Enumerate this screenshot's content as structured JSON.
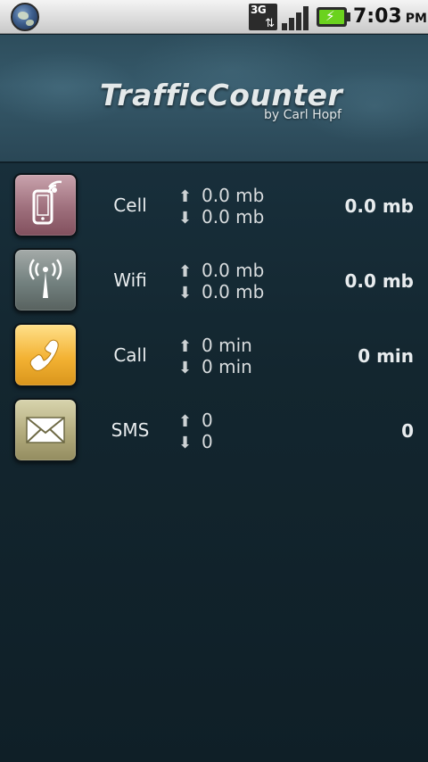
{
  "status_bar": {
    "network_label": "3G",
    "time": "7:03",
    "ampm": "PM",
    "battery_color": "#6bd21e",
    "icons": [
      "globe-icon",
      "3g-data-icon",
      "signal-strength-icon",
      "battery-charging-icon"
    ]
  },
  "header": {
    "title": "TrafficCounter",
    "subtitle": "by Carl Hopf"
  },
  "rows": [
    {
      "label": "Cell",
      "icon": "phone-signal-icon",
      "up": "0.0 mb",
      "down": "0.0 mb",
      "total": "0.0 mb",
      "tile_color": "#9e6f7c"
    },
    {
      "label": "Wifi",
      "icon": "wifi-antenna-icon",
      "up": "0.0 mb",
      "down": "0.0 mb",
      "total": "0.0 mb",
      "tile_color": "#72807e"
    },
    {
      "label": "Call",
      "icon": "phone-handset-icon",
      "up": "0 min",
      "down": "0 min",
      "total": "0 min",
      "tile_color": "#f3b233"
    },
    {
      "label": "SMS",
      "icon": "envelope-icon",
      "up": "0",
      "down": "0",
      "total": "0",
      "tile_color": "#b2ab7d"
    }
  ],
  "arrows": {
    "up": "⬆",
    "down": "⬇"
  }
}
